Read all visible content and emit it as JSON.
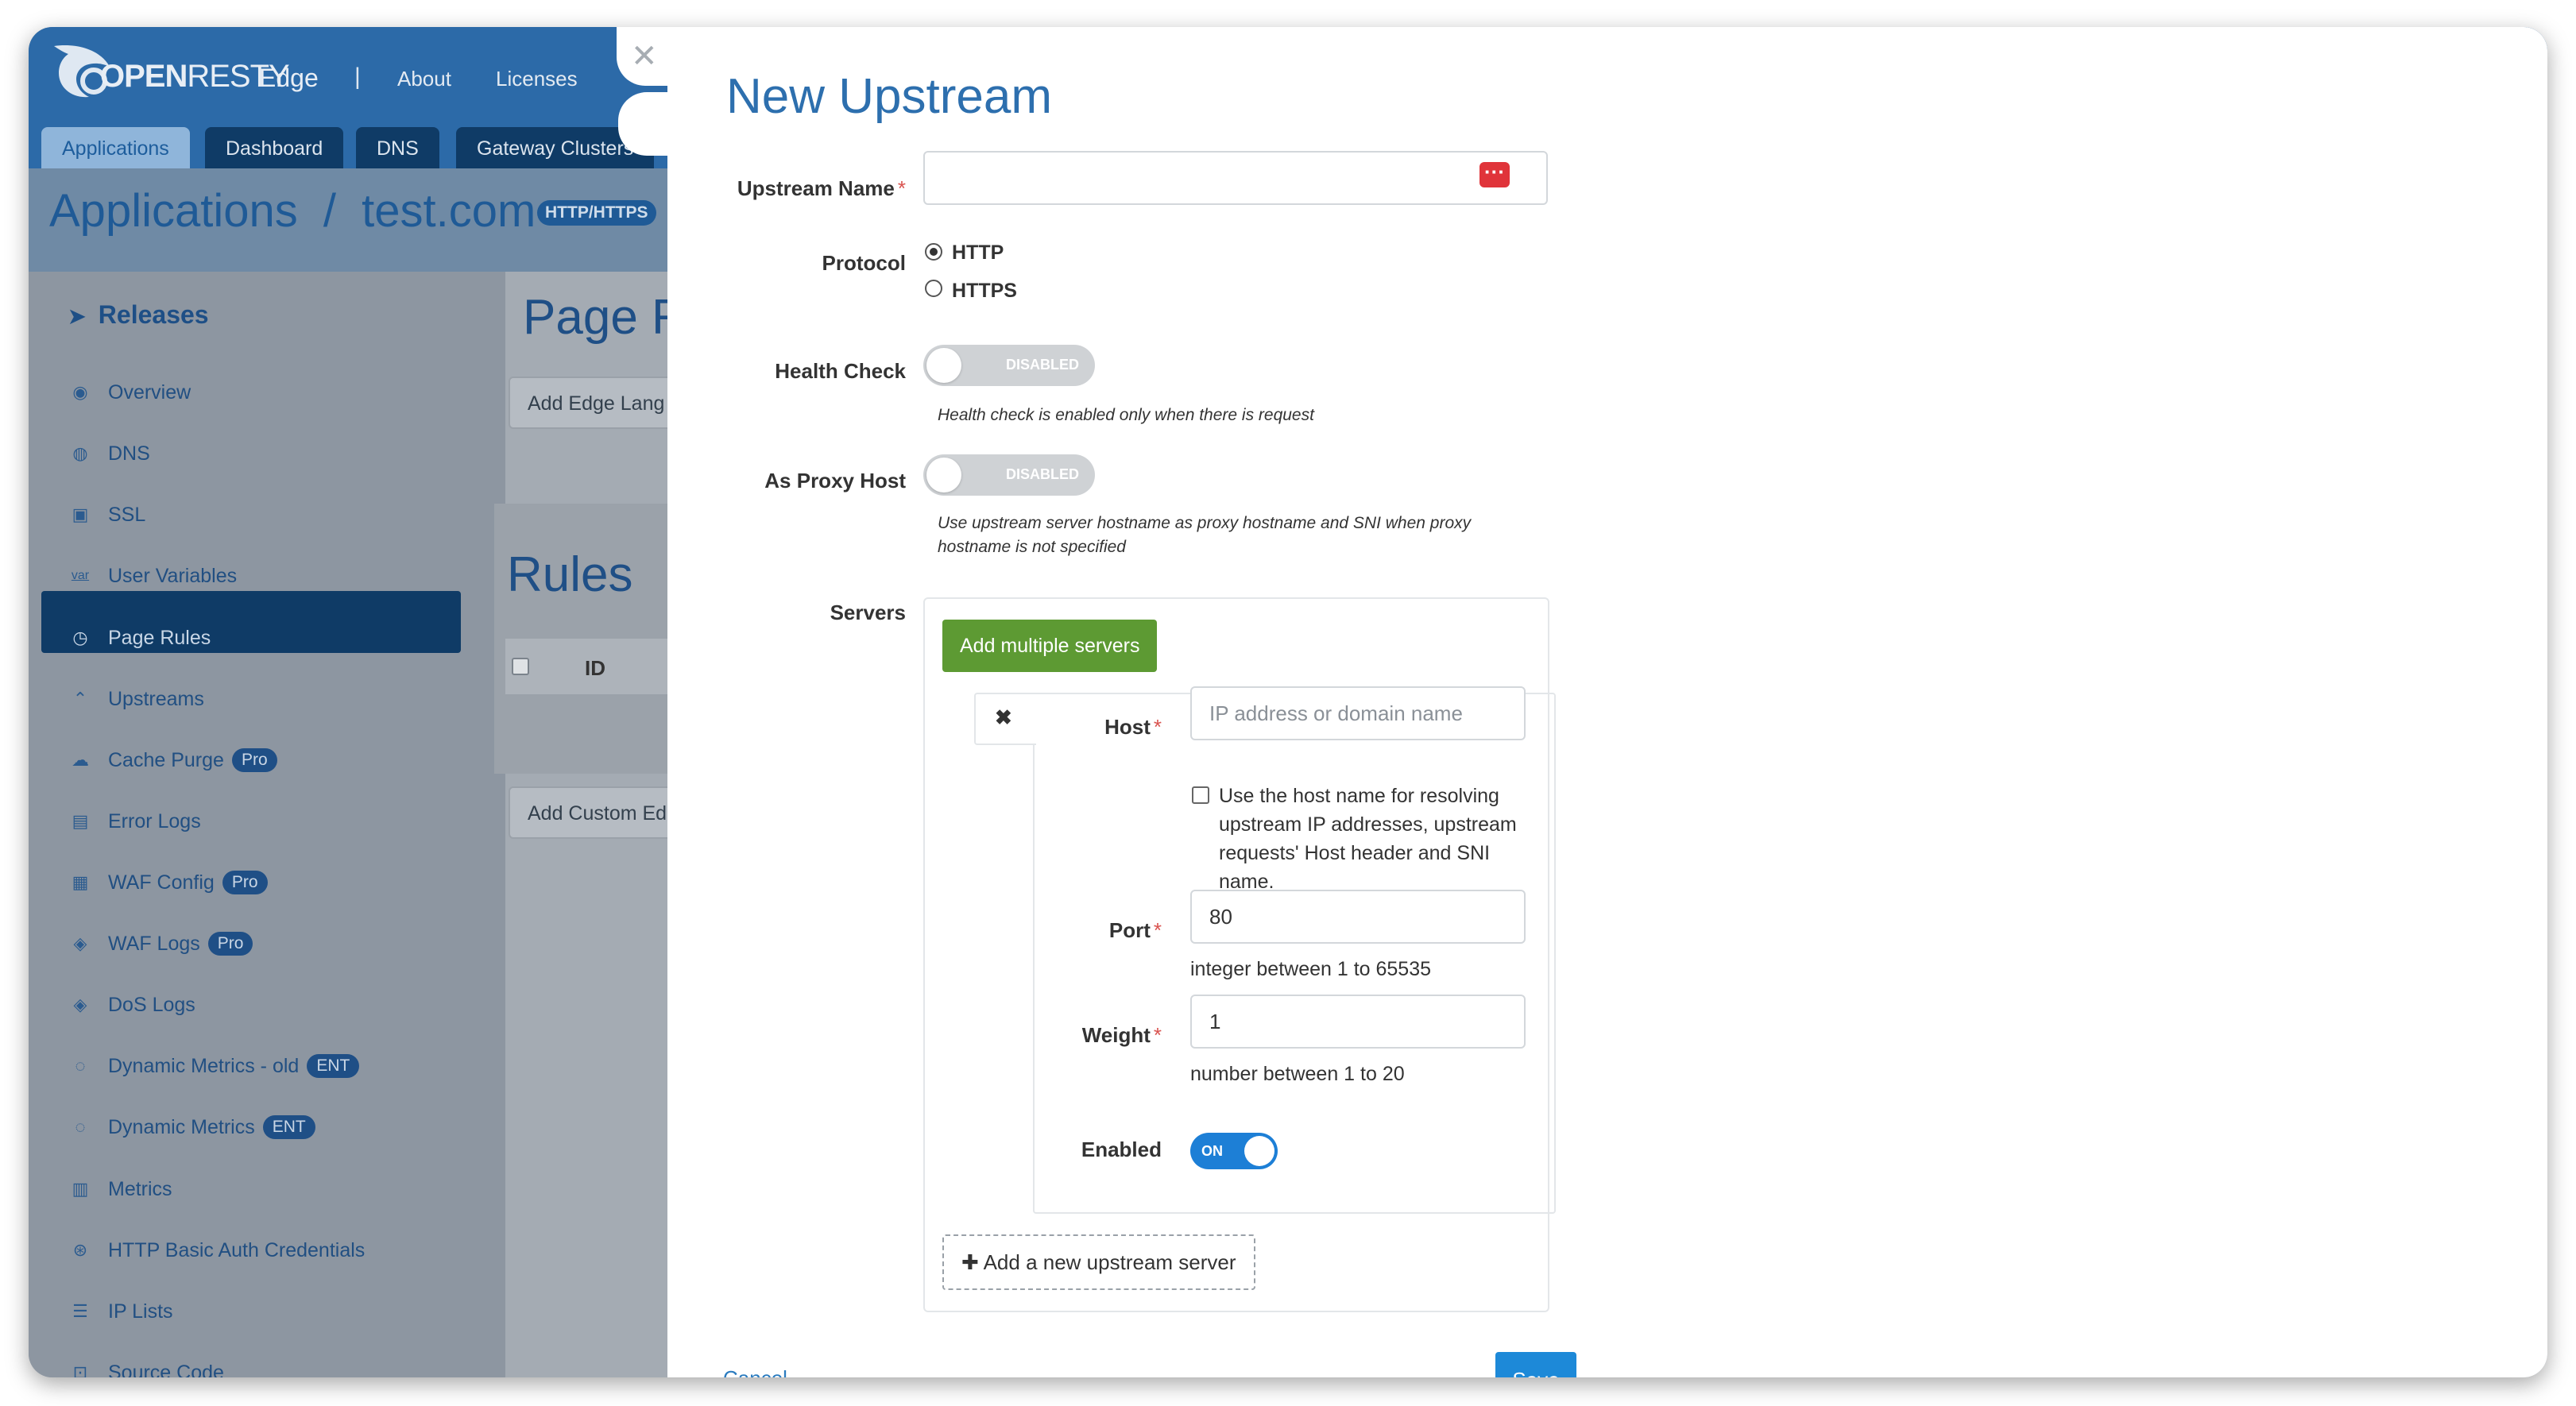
{
  "header": {
    "logo_bold": "OPEN",
    "logo_thin": "RESTY",
    "brand": "Edge",
    "separator": "|",
    "nav_links": [
      "About",
      "Licenses"
    ],
    "tabs": [
      "Applications",
      "Dashboard",
      "DNS",
      "Gateway Clusters"
    ]
  },
  "breadcrumb": {
    "root": "Applications",
    "sep": "/",
    "app": "test.com",
    "badge": "HTTP/HTTPS"
  },
  "sidebar": {
    "title": "Releases",
    "items": [
      {
        "label": "Overview",
        "icon": "dashboard-icon"
      },
      {
        "label": "DNS",
        "icon": "globe-icon"
      },
      {
        "label": "SSL",
        "icon": "certificate-icon"
      },
      {
        "label": "User Variables",
        "icon": "var-icon",
        "icon_text": "var"
      },
      {
        "label": "Page Rules",
        "icon": "rules-icon"
      },
      {
        "label": "Upstreams",
        "icon": "upstream-icon"
      },
      {
        "label": "Cache Purge",
        "icon": "cloud-icon",
        "badge": "Pro"
      },
      {
        "label": "Error Logs",
        "icon": "log-icon"
      },
      {
        "label": "WAF Config",
        "icon": "table-icon",
        "badge": "Pro"
      },
      {
        "label": "WAF Logs",
        "icon": "shield-log-icon",
        "badge": "Pro"
      },
      {
        "label": "DoS Logs",
        "icon": "shield-log-icon"
      },
      {
        "label": "Dynamic Metrics - old",
        "icon": "metrics-icon",
        "badge": "ENT"
      },
      {
        "label": "Dynamic Metrics",
        "icon": "metrics-icon",
        "badge": "ENT"
      },
      {
        "label": "Metrics",
        "icon": "bar-chart-icon"
      },
      {
        "label": "HTTP Basic Auth Credentials",
        "icon": "lock-icon"
      },
      {
        "label": "IP Lists",
        "icon": "list-icon"
      },
      {
        "label": "Source Code",
        "icon": "code-icon"
      }
    ]
  },
  "background_content": {
    "page_heading": "Page R",
    "add_edge_btn": "Add Edge Lang",
    "rules_heading": "Rules",
    "col_id": "ID",
    "add_custom_btn": "Add Custom Ed"
  },
  "modal": {
    "close_glyph": "✕",
    "title": "New Upstream",
    "upstream_name": {
      "label": "Upstream Name",
      "required": "*",
      "value": ""
    },
    "protocol": {
      "label": "Protocol",
      "options": [
        "HTTP",
        "HTTPS"
      ],
      "selected": "HTTP"
    },
    "health_check": {
      "label": "Health Check",
      "state": "DISABLED",
      "help": "Health check is enabled only when there is request"
    },
    "proxy_host": {
      "label": "As Proxy Host",
      "state": "DISABLED",
      "help_line1": "Use upstream server hostname as proxy hostname and SNI when proxy",
      "help_line2": "hostname is not specified"
    },
    "servers": {
      "label": "Servers",
      "add_multiple": "Add multiple servers",
      "remove_glyph": "✖",
      "host": {
        "label": "Host",
        "required": "*",
        "placeholder": "IP address or domain name"
      },
      "host_checkbox": "Use the host name for resolving upstream IP addresses, upstream requests' Host header and SNI name.",
      "port": {
        "label": "Port",
        "required": "*",
        "value": "80",
        "help": "integer between 1 to 65535"
      },
      "weight": {
        "label": "Weight",
        "required": "*",
        "value": "1",
        "help": "number between 1 to 20"
      },
      "enabled": {
        "label": "Enabled",
        "state": "ON"
      },
      "add_new": "Add a new upstream server",
      "add_glyph": "✚"
    },
    "cancel": "Cancel",
    "save": "Save"
  },
  "colors": {
    "primary_blue": "#2d6fae",
    "green": "#5d9a33",
    "save_blue": "#1d89d8",
    "danger": "#d9534f",
    "toggle_on": "#1d7fd6"
  }
}
